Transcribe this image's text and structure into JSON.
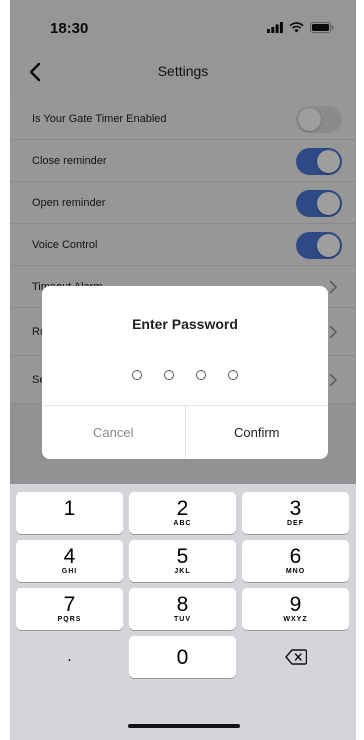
{
  "status_bar": {
    "time": "18:30"
  },
  "nav": {
    "title": "Settings"
  },
  "settings": [
    {
      "label": "Is Your Gate Timer Enabled",
      "control": "toggle",
      "on": false
    },
    {
      "label": "Close reminder",
      "control": "toggle",
      "on": true
    },
    {
      "label": "Open reminder",
      "control": "toggle",
      "on": true
    },
    {
      "label": "Voice Control",
      "control": "toggle",
      "on": true
    },
    {
      "label": "Timeout Alarm",
      "control": "chevron"
    },
    {
      "label": "Ru",
      "control": "chevron"
    },
    {
      "label": "Se",
      "control": "chevron"
    }
  ],
  "dialog": {
    "title": "Enter Password",
    "pin_length": 4,
    "cancel_label": "Cancel",
    "confirm_label": "Confirm"
  },
  "keypad": {
    "keys": [
      {
        "digit": "1",
        "letters": ""
      },
      {
        "digit": "2",
        "letters": "ABC"
      },
      {
        "digit": "3",
        "letters": "DEF"
      },
      {
        "digit": "4",
        "letters": "GHI"
      },
      {
        "digit": "5",
        "letters": "JKL"
      },
      {
        "digit": "6",
        "letters": "MNO"
      },
      {
        "digit": "7",
        "letters": "PQRS"
      },
      {
        "digit": "8",
        "letters": "TUV"
      },
      {
        "digit": "9",
        "letters": "WXYZ"
      }
    ],
    "decimal_label": ".",
    "zero": {
      "digit": "0"
    },
    "delete_icon": "backspace-icon"
  },
  "colors": {
    "toggle_on": "#4a78d8",
    "toggle_off": "#e0e0e4"
  }
}
